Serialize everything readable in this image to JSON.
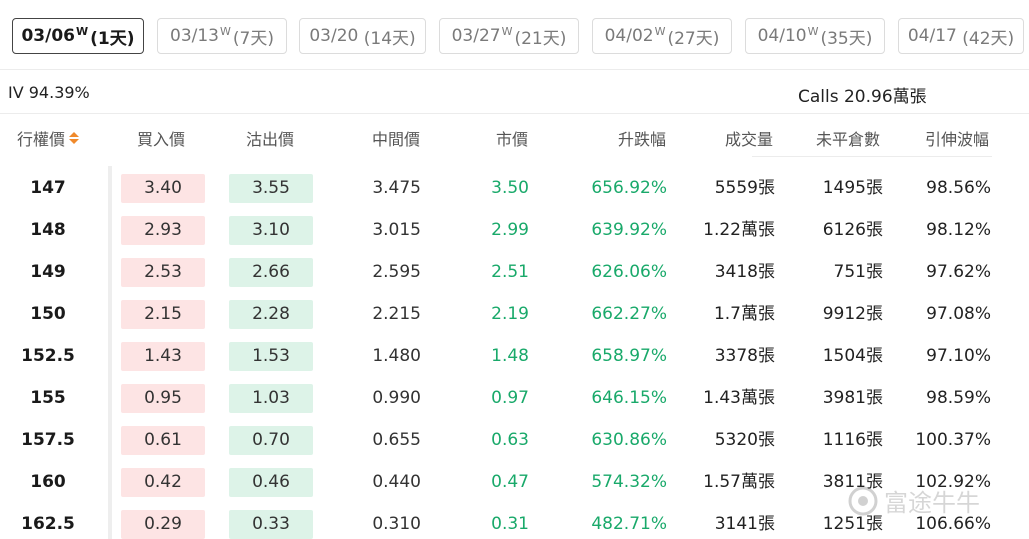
{
  "expiry_tabs": [
    {
      "date": "03/06",
      "weekly": true,
      "days": "(1天)",
      "active": true
    },
    {
      "date": "03/13",
      "weekly": true,
      "days": "(7天)",
      "active": false
    },
    {
      "date": "03/20",
      "weekly": false,
      "days": "(14天)",
      "active": false
    },
    {
      "date": "03/27",
      "weekly": true,
      "days": "(21天)",
      "active": false
    },
    {
      "date": "04/02",
      "weekly": true,
      "days": "(27天)",
      "active": false
    },
    {
      "date": "04/10",
      "weekly": true,
      "days": "(35天)",
      "active": false
    },
    {
      "date": "04/17",
      "weekly": false,
      "days": "(42天)",
      "active": false
    }
  ],
  "weekly_marker": "W",
  "summary": {
    "iv": "IV 94.39%",
    "calls": "Calls 20.96萬張"
  },
  "columns": {
    "strike": "行權價",
    "bid": "買入價",
    "ask": "沽出價",
    "mid": "中間價",
    "last": "市價",
    "change": "升跌幅",
    "volume": "成交量",
    "open_interest": "未平倉數",
    "iv": "引伸波幅"
  },
  "rows": [
    {
      "strike": "147",
      "bid": "3.40",
      "ask": "3.55",
      "mid": "3.475",
      "last": "3.50",
      "change": "656.92%",
      "volume": "5559張",
      "oi": "1495張",
      "iv": "98.56%"
    },
    {
      "strike": "148",
      "bid": "2.93",
      "ask": "3.10",
      "mid": "3.015",
      "last": "2.99",
      "change": "639.92%",
      "volume": "1.22萬張",
      "oi": "6126張",
      "iv": "98.12%"
    },
    {
      "strike": "149",
      "bid": "2.53",
      "ask": "2.66",
      "mid": "2.595",
      "last": "2.51",
      "change": "626.06%",
      "volume": "3418張",
      "oi": "751張",
      "iv": "97.62%"
    },
    {
      "strike": "150",
      "bid": "2.15",
      "ask": "2.28",
      "mid": "2.215",
      "last": "2.19",
      "change": "662.27%",
      "volume": "1.7萬張",
      "oi": "9912張",
      "iv": "97.08%"
    },
    {
      "strike": "152.5",
      "bid": "1.43",
      "ask": "1.53",
      "mid": "1.480",
      "last": "1.48",
      "change": "658.97%",
      "volume": "3378張",
      "oi": "1504張",
      "iv": "97.10%"
    },
    {
      "strike": "155",
      "bid": "0.95",
      "ask": "1.03",
      "mid": "0.990",
      "last": "0.97",
      "change": "646.15%",
      "volume": "1.43萬張",
      "oi": "3981張",
      "iv": "98.59%"
    },
    {
      "strike": "157.5",
      "bid": "0.61",
      "ask": "0.70",
      "mid": "0.655",
      "last": "0.63",
      "change": "630.86%",
      "volume": "5320張",
      "oi": "1116張",
      "iv": "100.37%"
    },
    {
      "strike": "160",
      "bid": "0.42",
      "ask": "0.46",
      "mid": "0.440",
      "last": "0.47",
      "change": "574.32%",
      "volume": "1.57萬張",
      "oi": "3811張",
      "iv": "102.92%"
    },
    {
      "strike": "162.5",
      "bid": "0.29",
      "ask": "0.33",
      "mid": "0.310",
      "last": "0.31",
      "change": "482.71%",
      "volume": "3141張",
      "oi": "1251張",
      "iv": "106.66%"
    }
  ],
  "watermark": "富途牛牛",
  "colors": {
    "up_green": "#19a96a",
    "bid_bg": "#fde4e4",
    "ask_bg": "#ddf3e8",
    "sort_accent": "#f08a2c"
  },
  "icons": {
    "sort": "sort-arrows-icon",
    "watermark": "futu-logo-icon"
  }
}
